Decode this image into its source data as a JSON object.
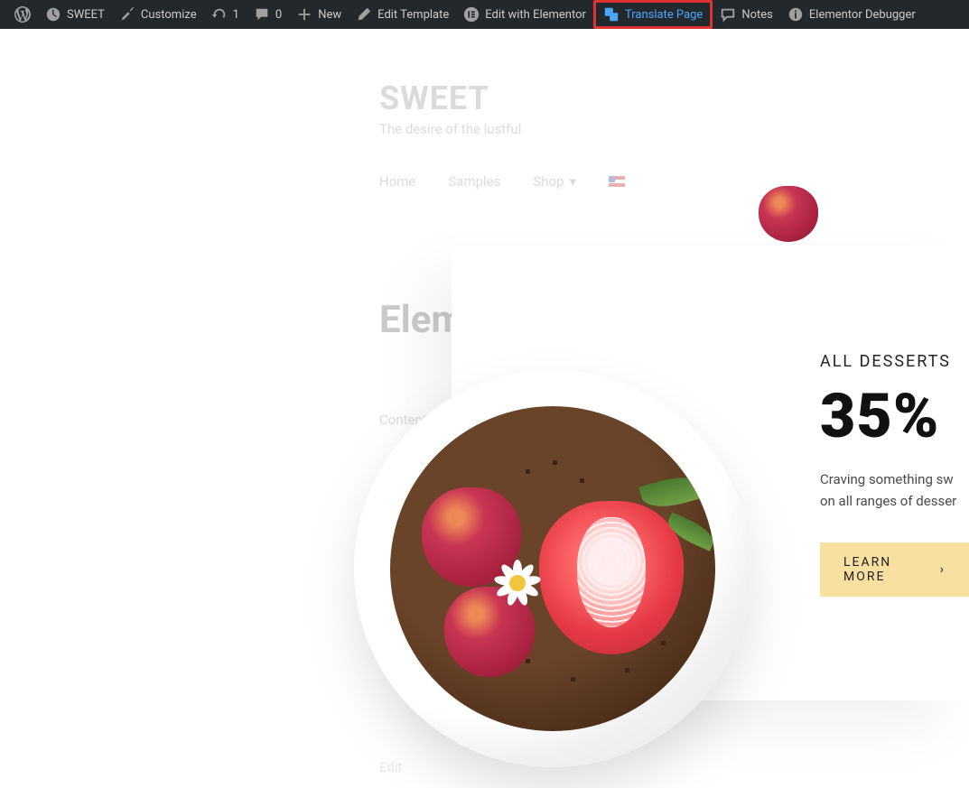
{
  "adminBar": {
    "site_name": "SWEET",
    "customize": "Customize",
    "updates_count": "1",
    "comments_count": "0",
    "new": "New",
    "edit_template": "Edit Template",
    "edit_elementor": "Edit with Elementor",
    "translate_page": "Translate Page",
    "notes": "Notes",
    "elementor_debugger": "Elementor Debugger"
  },
  "site": {
    "title": "SWEET",
    "tagline": "The desire of the lustful"
  },
  "nav": {
    "home": "Home",
    "samples": "Samples",
    "shop": "Shop"
  },
  "page_heading": "Elem",
  "content_area_label": "Content Area",
  "edit_link": "Edit",
  "hero": {
    "eyebrow": "ALL DESSERTS",
    "headline": "35%",
    "desc1": "Craving something sw",
    "desc2": "on all ranges of desser",
    "button": "LEARN MORE"
  }
}
